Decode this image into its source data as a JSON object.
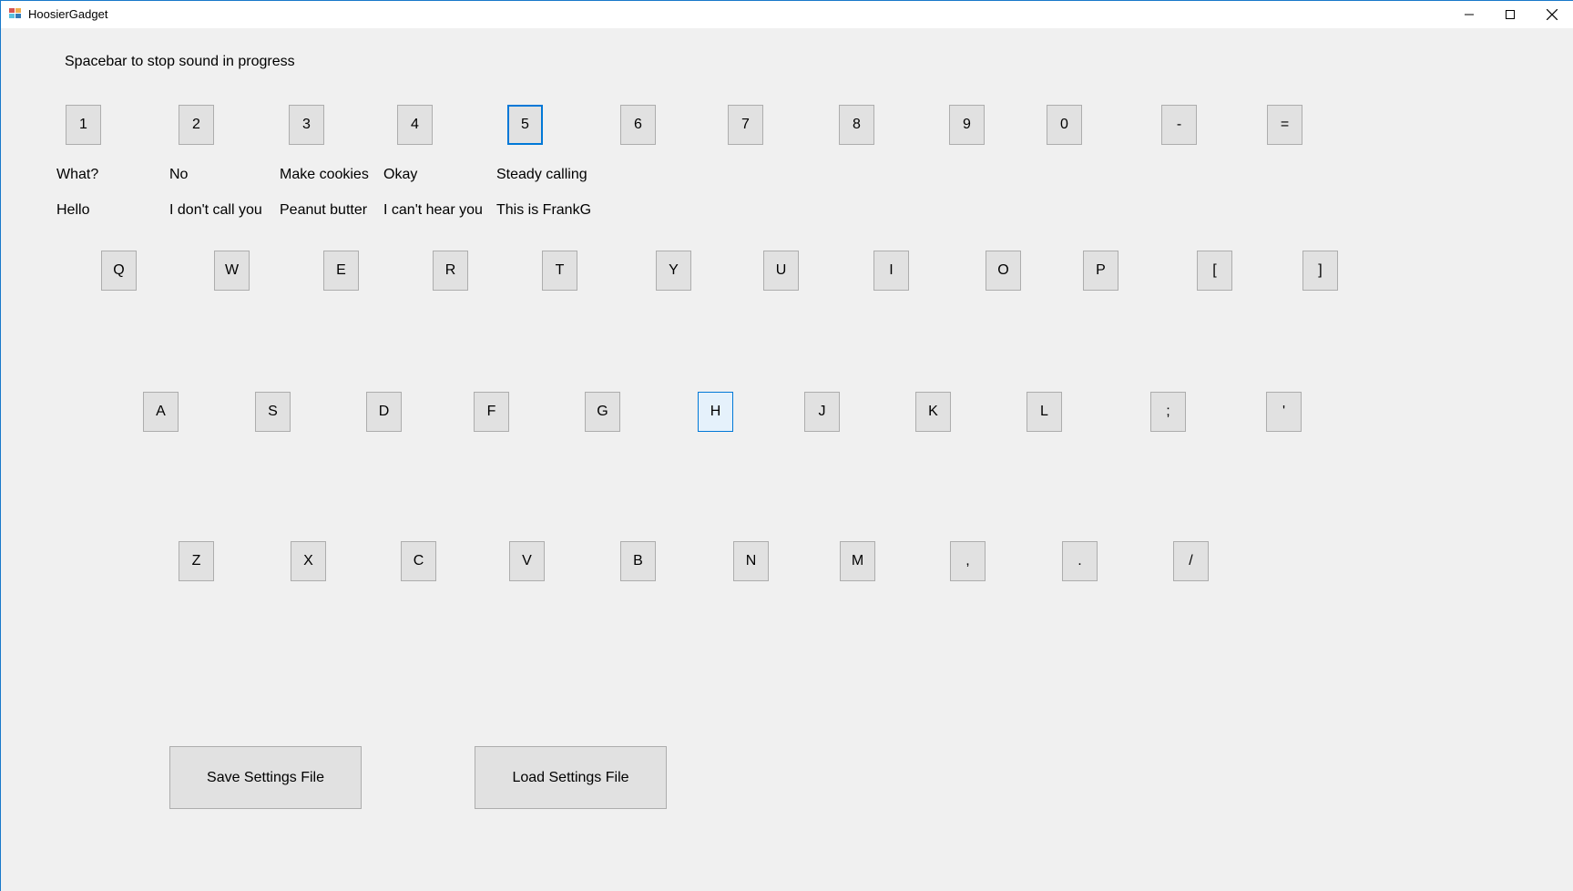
{
  "window": {
    "title": "HoosierGadget"
  },
  "instructions": "Spacebar to stop sound in progress",
  "number_row": [
    {
      "key": "1",
      "label_top": "What?",
      "label_bottom": "Hello"
    },
    {
      "key": "2",
      "label_top": "No",
      "label_bottom": "I don't call you"
    },
    {
      "key": "3",
      "label_top": "Make cookies",
      "label_bottom": "Peanut butter"
    },
    {
      "key": "4",
      "label_top": "Okay",
      "label_bottom": "I can't hear you"
    },
    {
      "key": "5",
      "label_top": "Steady calling",
      "label_bottom": "This is FrankG"
    },
    {
      "key": "6"
    },
    {
      "key": "7"
    },
    {
      "key": "8"
    },
    {
      "key": "9"
    },
    {
      "key": "0"
    },
    {
      "key": "-"
    },
    {
      "key": "="
    }
  ],
  "qwerty_row": [
    "Q",
    "W",
    "E",
    "R",
    "T",
    "Y",
    "U",
    "I",
    "O",
    "P",
    "[",
    "]"
  ],
  "home_row": [
    "A",
    "S",
    "D",
    "F",
    "G",
    "H",
    "J",
    "K",
    "L",
    ";",
    "'"
  ],
  "bottom_row": [
    "Z",
    "X",
    "C",
    "V",
    "B",
    "N",
    "M",
    ",",
    ".",
    "/"
  ],
  "focused_key": "5",
  "hovered_key": "H",
  "buttons": {
    "save": "Save Settings File",
    "load": "Load Settings File"
  },
  "colors": {
    "background": "#f0f0f0",
    "button_face": "#e1e1e1",
    "button_border": "#adadad",
    "accent": "#0078d7",
    "hover_face": "#e5f1fb"
  }
}
